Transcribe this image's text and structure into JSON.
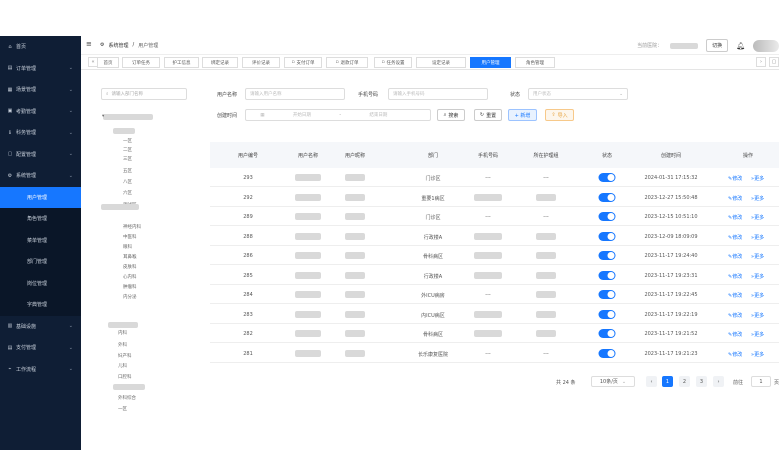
{
  "sidebar": {
    "items": [
      {
        "icon": "home-icon",
        "glyph": "⌂",
        "label": "首页",
        "chevron": false
      },
      {
        "icon": "order-icon",
        "glyph": "▤",
        "label": "订单管理",
        "chevron": true
      },
      {
        "icon": "grid-icon",
        "glyph": "▦",
        "label": "场景管理",
        "chevron": true
      },
      {
        "icon": "doc-icon",
        "glyph": "▣",
        "label": "考勤管理",
        "chevron": true
      },
      {
        "icon": "info-icon",
        "glyph": "ℹ",
        "label": "科务管理",
        "chevron": true
      },
      {
        "icon": "config-icon",
        "glyph": "▢",
        "label": "配置管理",
        "chevron": true
      },
      {
        "icon": "gear-icon",
        "glyph": "⚙",
        "label": "系统管理",
        "chevron": true
      }
    ],
    "sub_items": [
      "用户管理",
      "角色管理",
      "菜单管理",
      "部门管理",
      "岗位管理",
      "字典管理"
    ],
    "bottom_items": [
      {
        "icon": "monitor-icon",
        "glyph": "▥",
        "label": "基础设施",
        "chevron": true
      },
      {
        "icon": "pay-icon",
        "glyph": "▤",
        "label": "支付管理",
        "chevron": true
      },
      {
        "icon": "flow-icon",
        "glyph": "⌁",
        "label": "工作流程",
        "chevron": true
      }
    ]
  },
  "header": {
    "breadcrumb_root": "系统管理",
    "breadcrumb_sep": "/",
    "breadcrumb_current": "用户管理",
    "school_label": "当前医院：",
    "switch_label": "切换"
  },
  "tabs": [
    "首页",
    "订单任务",
    "护工信息",
    "绑定记录",
    "评价记录",
    "支付订单",
    "退款订单",
    "任务设置",
    "设定记录",
    "用户管理",
    "角色管理"
  ],
  "tree": {
    "search_placeholder": "请输入部门名称",
    "nodes": [
      "一区",
      "二区",
      "三区",
      "五区",
      "八区",
      "六区",
      "测试区",
      "神经内科",
      "内科",
      "外科",
      "妇产科",
      "儿科",
      "口腔科",
      "中医科",
      "眼科",
      "耳鼻喉",
      "皮肤科",
      "心内科",
      "肿瘤科",
      "内分泌",
      "外科综合",
      "一区"
    ]
  },
  "form": {
    "username_label": "用户名称",
    "username_placeholder": "请输入用户名称",
    "phone_label": "手机号码",
    "phone_placeholder": "请输入手机号码",
    "status_label": "状态",
    "status_placeholder": "用户状态",
    "time_label": "创建时间",
    "start_placeholder": "开始日期",
    "range_sep": "-",
    "end_placeholder": "结束日期",
    "search_btn": "搜索",
    "reset_btn": "重置",
    "add_btn": "+ 新增",
    "import_btn": "导入"
  },
  "table": {
    "headers": [
      "用户编号",
      "用户名称",
      "用户昵称",
      "部门",
      "手机号码",
      "所在护理组",
      "状态",
      "创建时间",
      "操作"
    ],
    "rows": [
      {
        "id": "293",
        "dept": "门诊区",
        "phone": "---",
        "group": "---",
        "time": "2024-01-31 17:15:32"
      },
      {
        "id": "292",
        "dept": "重要1病区",
        "phone": "",
        "group": "",
        "time": "2023-12-27 15:50:48"
      },
      {
        "id": "289",
        "dept": "门诊区",
        "phone": "---",
        "group": "---",
        "time": "2023-12-15 10:51:10"
      },
      {
        "id": "288",
        "dept": "行政楼A",
        "phone": "",
        "group": "",
        "time": "2023-12-09 18:09:09"
      },
      {
        "id": "286",
        "dept": "骨科病区",
        "phone": "",
        "group": "",
        "time": "2023-11-17 19:24:40"
      },
      {
        "id": "285",
        "dept": "行政楼A",
        "phone": "",
        "group": "",
        "time": "2023-11-17 19:23:31"
      },
      {
        "id": "284",
        "dept": "外ICU病房",
        "phone": "---",
        "group": "",
        "time": "2023-11-17 19:22:45"
      },
      {
        "id": "283",
        "dept": "内ICU病区",
        "phone": "",
        "group": "",
        "time": "2023-11-17 19:22:19"
      },
      {
        "id": "282",
        "dept": "骨科病区",
        "phone": "",
        "group": "",
        "time": "2023-11-17 19:21:52"
      },
      {
        "id": "281",
        "dept": "长乐康复医院",
        "phone": "---",
        "group": "---",
        "time": "2023-11-17 19:21:23"
      }
    ],
    "edit_label": "修改",
    "more_label": "更多"
  },
  "pagination": {
    "total": "共 24 条",
    "page_size": "10条/页",
    "pages": [
      "1",
      "2",
      "3"
    ],
    "goto_label": "前往",
    "goto_value": "1",
    "page_suffix": "页"
  }
}
